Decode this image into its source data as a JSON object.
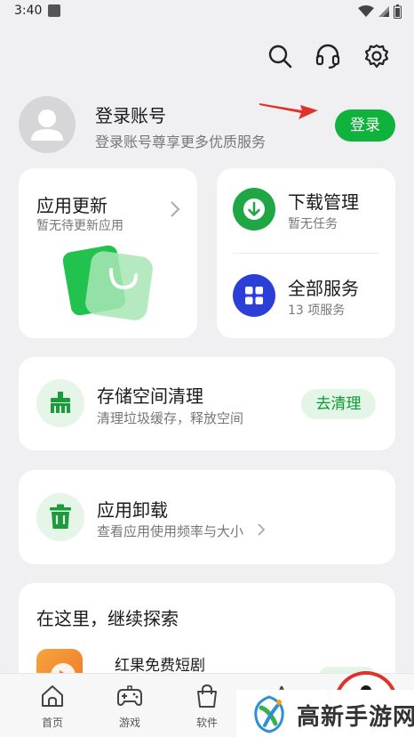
{
  "status_bar": {
    "time": "3:40"
  },
  "toolbar": {
    "search_icon": "search-icon",
    "support_icon": "headset-icon",
    "settings_icon": "gear-icon"
  },
  "account": {
    "title": "登录账号",
    "subtitle": "登录账号尊享更多优质服务",
    "login_label": "登录"
  },
  "update_card": {
    "title": "应用更新",
    "subtitle": "暂无待更新应用"
  },
  "services": {
    "download": {
      "title": "下载管理",
      "subtitle": "暂无任务"
    },
    "all": {
      "title": "全部服务",
      "subtitle": "13 项服务"
    }
  },
  "storage": {
    "title": "存储空间清理",
    "subtitle": "清理垃圾缓存，释放空间",
    "action_label": "去清理"
  },
  "uninstall": {
    "title": "应用卸载",
    "subtitle": "查看应用使用频率与大小"
  },
  "explore": {
    "title": "在这里，继续探索",
    "app_name": "红果免费短剧"
  },
  "bottom_nav": {
    "items": [
      {
        "label": "首页",
        "icon": "home-icon"
      },
      {
        "label": "游戏",
        "icon": "gamepad-icon"
      },
      {
        "label": "软件",
        "icon": "shopping-bag-icon"
      }
    ]
  },
  "watermark": {
    "text": "高新手游网"
  },
  "colors": {
    "accent": "#0fb23b",
    "blue": "#2b3fd8",
    "arrow": "#e0322a"
  }
}
